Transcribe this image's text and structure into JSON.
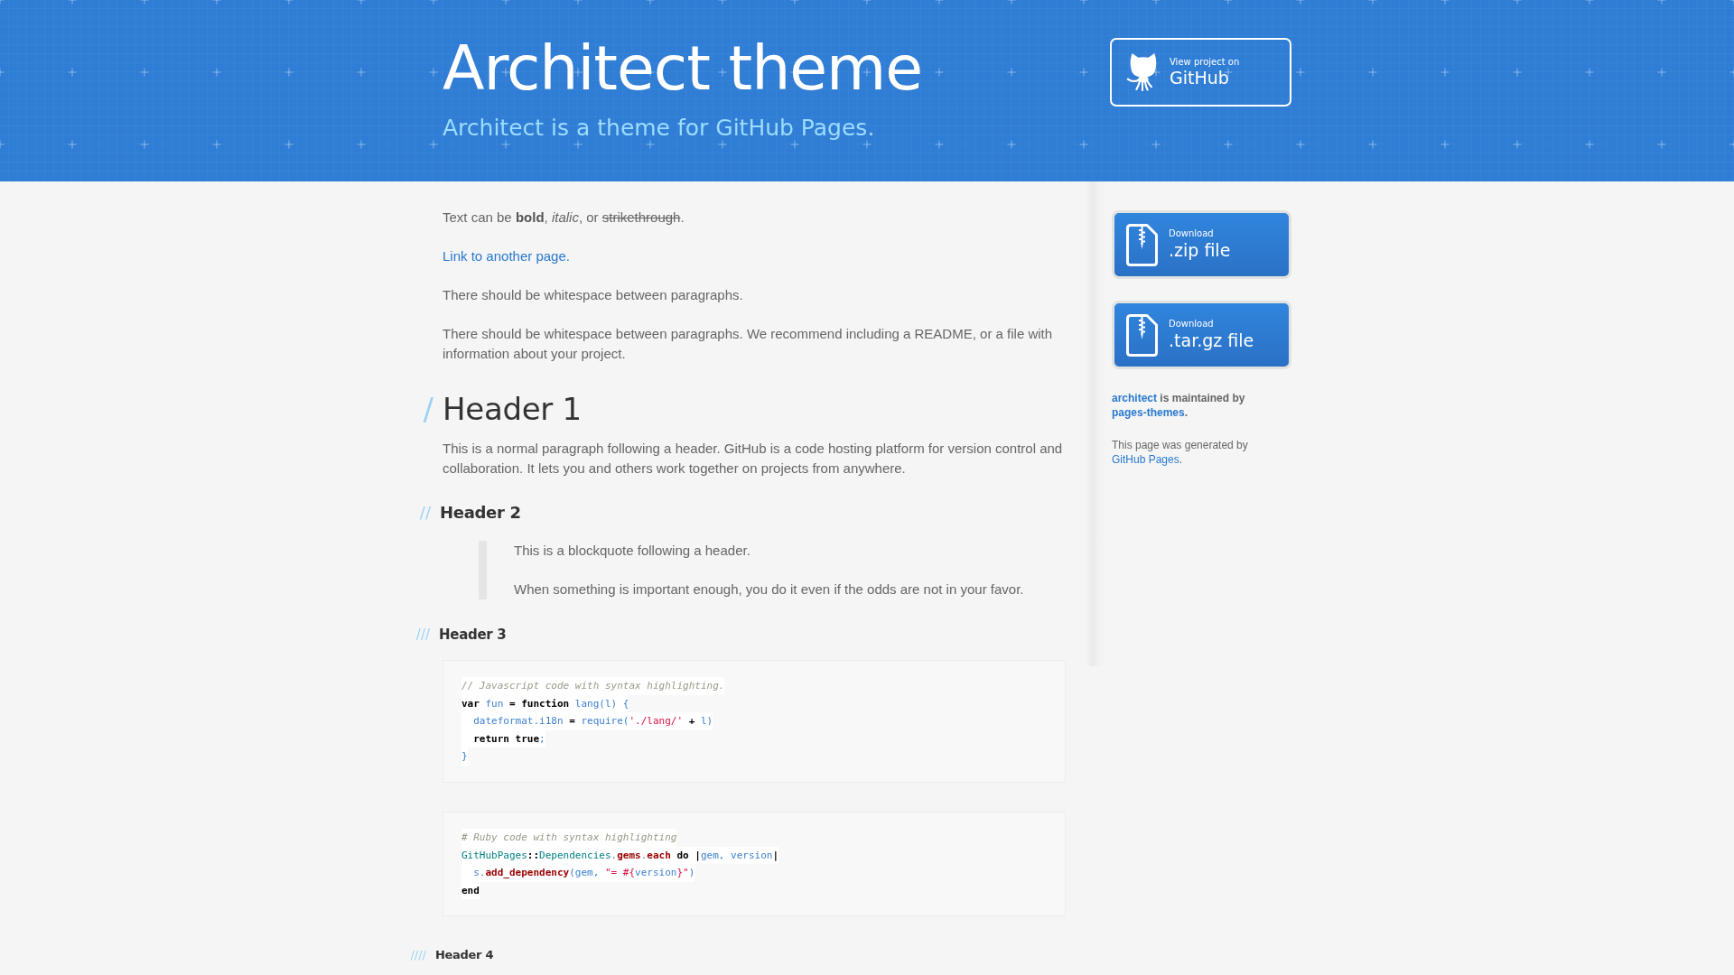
{
  "header": {
    "title": "Architect theme",
    "tagline": "Architect is a theme for GitHub Pages.",
    "github_button": {
      "caption": "View project on",
      "label": "GitHub"
    }
  },
  "content": [
    {
      "kind": "paragraph",
      "segments": [
        {
          "kind": "plain",
          "text": "Text can be "
        },
        {
          "kind": "bold",
          "text": "bold"
        },
        {
          "kind": "plain",
          "text": ", "
        },
        {
          "kind": "italic",
          "text": "italic"
        },
        {
          "kind": "plain",
          "text": ", or "
        },
        {
          "kind": "strike",
          "text": "strikethrough"
        },
        {
          "kind": "plain",
          "text": "."
        }
      ]
    },
    {
      "kind": "link",
      "text": "Link to another page."
    },
    {
      "kind": "paragraph",
      "segments": [
        {
          "kind": "plain",
          "text": "There should be whitespace between paragraphs."
        }
      ]
    },
    {
      "kind": "paragraph",
      "segments": [
        {
          "kind": "plain",
          "text": "There should be whitespace between paragraphs. We recommend including a README, or a file with information about your project."
        }
      ]
    },
    {
      "kind": "h1",
      "marker": "/",
      "text": "Header 1"
    },
    {
      "kind": "paragraph",
      "segments": [
        {
          "kind": "plain",
          "text": "This is a normal paragraph following a header. GitHub is a code hosting platform for version control and collaboration. It lets you and others work together on projects from anywhere."
        }
      ]
    },
    {
      "kind": "h2",
      "marker": "//",
      "text": "Header 2"
    },
    {
      "kind": "blockquote",
      "paragraphs": [
        "This is a blockquote following a header.",
        "When something is important enough, you do it even if the odds are not in your favor."
      ]
    },
    {
      "kind": "h3",
      "marker": "///",
      "text": "Header 3"
    },
    {
      "kind": "code",
      "lines": [
        {
          "tokens": [
            {
              "kind": "comment",
              "text": "// Javascript code with syntax highlighting."
            }
          ]
        },
        {
          "tokens": [
            {
              "kind": "keyword",
              "text": "var"
            },
            {
              "kind": "name",
              "text": " fun "
            },
            {
              "kind": "operator",
              "text": "="
            },
            {
              "kind": "keyword",
              "text": " function"
            },
            {
              "kind": "name",
              "text": " lang(l) {"
            }
          ]
        },
        {
          "tokens": [
            {
              "kind": "name",
              "text": "  dateformat.i18n "
            },
            {
              "kind": "operator",
              "text": "="
            },
            {
              "kind": "name",
              "text": " require("
            },
            {
              "kind": "string",
              "text": "'./lang/'"
            },
            {
              "kind": "operator",
              "text": " + "
            },
            {
              "kind": "name",
              "text": "l)"
            }
          ]
        },
        {
          "tokens": [
            {
              "kind": "keyword",
              "text": "  return true"
            },
            {
              "kind": "name",
              "text": ";"
            }
          ]
        },
        {
          "tokens": [
            {
              "kind": "name",
              "text": "}"
            }
          ]
        }
      ]
    },
    {
      "kind": "code",
      "lines": [
        {
          "tokens": [
            {
              "kind": "comment",
              "text": "# Ruby code with syntax highlighting"
            }
          ]
        },
        {
          "tokens": [
            {
              "kind": "constant",
              "text": "GitHubPages"
            },
            {
              "kind": "operator",
              "text": "::"
            },
            {
              "kind": "constant",
              "text": "Dependencies"
            },
            {
              "kind": "name",
              "text": "."
            },
            {
              "kind": "method",
              "text": "gems"
            },
            {
              "kind": "name",
              "text": "."
            },
            {
              "kind": "method",
              "text": "each"
            },
            {
              "kind": "keyword",
              "text": " do "
            },
            {
              "kind": "operator",
              "text": "|"
            },
            {
              "kind": "name",
              "text": "gem, version"
            },
            {
              "kind": "operator",
              "text": "|"
            }
          ]
        },
        {
          "tokens": [
            {
              "kind": "name",
              "text": "  s."
            },
            {
              "kind": "method",
              "text": "add_dependency"
            },
            {
              "kind": "name",
              "text": "(gem, "
            },
            {
              "kind": "string",
              "text": "\"= #{"
            },
            {
              "kind": "name",
              "text": "version"
            },
            {
              "kind": "string",
              "text": "}\""
            },
            {
              "kind": "name",
              "text": ")"
            }
          ]
        },
        {
          "tokens": [
            {
              "kind": "keyword",
              "text": "end"
            }
          ]
        }
      ]
    },
    {
      "kind": "h4",
      "marker": "////",
      "text": "Header 4"
    }
  ],
  "sidebar": {
    "downloads": [
      {
        "caption": "Download",
        "label": ".zip file"
      },
      {
        "caption": "Download",
        "label": ".tar.gz file"
      }
    ],
    "notes": [
      {
        "kind": "bold",
        "segments": [
          {
            "kind": "link",
            "text": "architect"
          },
          {
            "kind": "plain",
            "text": " is maintained by "
          },
          {
            "kind": "link",
            "text": "pages-themes"
          },
          {
            "kind": "plain",
            "text": "."
          }
        ]
      },
      {
        "kind": "plain",
        "segments": [
          {
            "kind": "plain",
            "text": "This page was generated by "
          },
          {
            "kind": "link",
            "text": "GitHub Pages"
          },
          {
            "kind": "plain",
            "text": "."
          }
        ]
      }
    ]
  }
}
